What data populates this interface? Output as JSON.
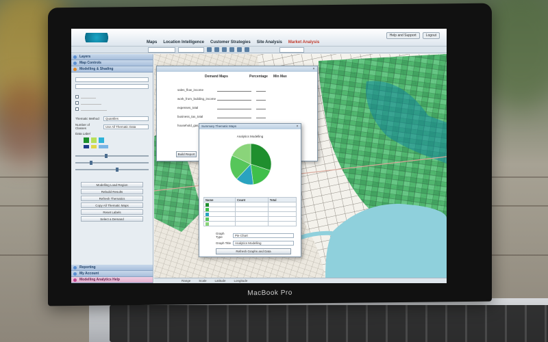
{
  "app": {
    "nav_tabs": [
      "Maps",
      "Location Intelligence",
      "Customer Strategies",
      "Site Analysis",
      "Market Analysis"
    ],
    "active_tab": "Market Analysis",
    "top_actions": [
      "Help and Support",
      "Logout"
    ]
  },
  "sidebar": {
    "accordion": [
      "Layers",
      "Map Controls",
      "Modelling & Shading"
    ],
    "bottom_accordion": [
      "Reporting",
      "My Account",
      "Modelling Analytics Help"
    ],
    "buttons": [
      "Modelling Load Region",
      "Rebuild Results",
      "Refresh Thematics",
      "Copy All Thematic Maps",
      "Reset Labels",
      "Select a Demand"
    ],
    "labels": [
      "Thematic Method",
      "Number of Classes",
      "Data Label"
    ],
    "selects": [
      "Quantiles",
      "Use All Thematic Data"
    ]
  },
  "dialog_main": {
    "header_col1": "Demand Maps",
    "header_col2": "Percentage",
    "header_col3": "Min Max",
    "rows": [
      "sales_flow_income",
      "work_from_building_income",
      "expenses_total",
      "business_tax_total",
      "household_gas_total"
    ],
    "button": "Build Report"
  },
  "dialog_summary": {
    "title": "Summary Thematic Maps",
    "chart_title": "Analytics Modelling",
    "table_headers": [
      "Name",
      "Count",
      "Total"
    ],
    "graph_type_label": "Graph Type",
    "graph_type_value": "Pie Chart",
    "graph_title_label": "Graph Title",
    "graph_title_value": "Analytics Modelling",
    "button": "Refresh Graphs and Data"
  },
  "status": [
    "Range",
    "Scale",
    "Latitude",
    "Longitude"
  ],
  "laptop": {
    "brand": "MacBook Pro"
  },
  "chart_data": {
    "type": "pie",
    "slices": [
      {
        "value": 30,
        "color": "#1f8f2e"
      },
      {
        "value": 18,
        "color": "#3fbf4a"
      },
      {
        "value": 14,
        "color": "#2aa3c0"
      },
      {
        "value": 20,
        "color": "#56c65a"
      },
      {
        "value": 18,
        "color": "#8ad47a"
      }
    ]
  }
}
